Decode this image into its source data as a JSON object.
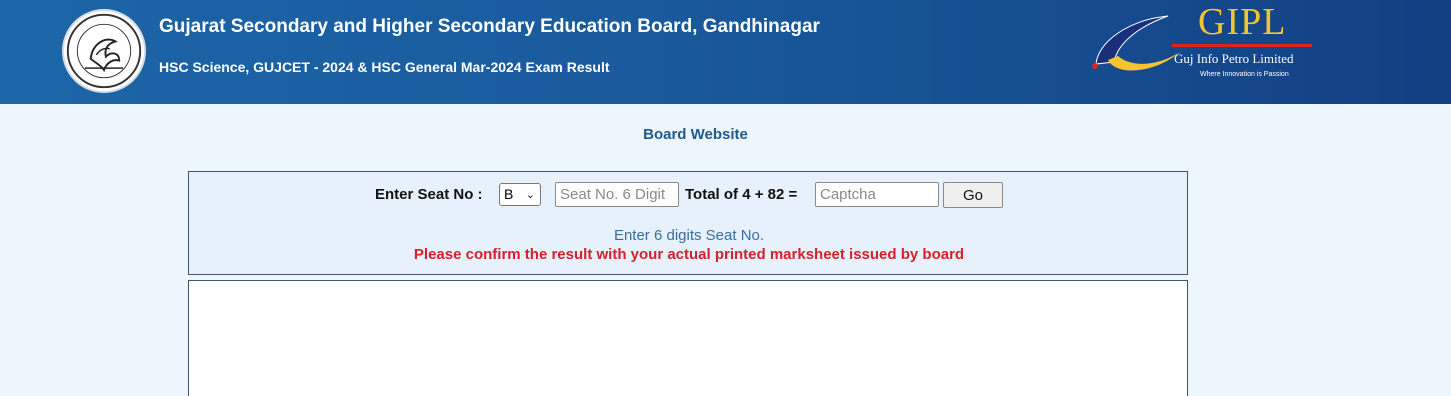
{
  "header": {
    "title": "Gujarat Secondary and Higher Secondary Education Board, Gandhinagar",
    "subtitle": "HSC Science, GUJCET - 2024 & HSC General Mar-2024 Exam Result",
    "seal_icon": "board-seal-icon",
    "partner_logo": {
      "name": "GIPL",
      "company": "Guj Info Petro Limited",
      "tagline": "Where Innovation is Passion",
      "colors": {
        "gold": "#f4c430",
        "red": "#e2231a"
      }
    },
    "colors": {
      "band_start": "#1c66a8",
      "band_end": "#123f82"
    }
  },
  "board_link": "Board Website",
  "form": {
    "seat_label": "Enter Seat No :",
    "series_select_value": "B",
    "seat_placeholder": "Seat No. 6 Digit",
    "captcha_label": "Total of 4 + 82 =",
    "captcha_placeholder": "Captcha",
    "go_label": "Go",
    "hint": "Enter 6 digits Seat No.",
    "warning": "Please confirm the result with your actual printed marksheet issued by board",
    "colors": {
      "hint": "#3b6ea0",
      "warning": "#d8202a",
      "panel": "#e6f1fb"
    }
  }
}
